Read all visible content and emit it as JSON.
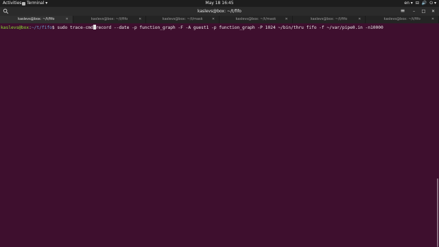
{
  "topbar": {
    "activities": "Activities",
    "app_menu": "Terminal ▾",
    "clock": "May 18  16:45",
    "tray": [
      "en ▾",
      "⊟",
      "🔊",
      "⏻ ▾"
    ]
  },
  "window": {
    "title": "kaslevs@box: ~/t/fifo"
  },
  "tabs": [
    {
      "label": "kaslevs@box: ~/t/fifo",
      "active": true
    },
    {
      "label": "kaslevs@box: ~/t/fifo",
      "active": false
    },
    {
      "label": "kaslevs@box: ~/t/mask",
      "active": false
    },
    {
      "label": "kaslevs@box: ~/t/mask",
      "active": false
    },
    {
      "label": "kaslevs@box: ~/t/fifo",
      "active": false
    },
    {
      "label": "kaslevs@box: ~/t/fifo",
      "active": false
    }
  ],
  "terminal": {
    "prompt_user": "kaslevs@box",
    "prompt_sep": ":",
    "prompt_path": "~/t/fifo",
    "prompt_end": "$ ",
    "cmd_before_cursor": "sudo trace-cmd",
    "cmd_after_cursor": "record --date -p function_graph -F -A guest1 -p function_graph -P 1024 ~/bin/thru fifo -f ~/var/pipe0.in -n10000"
  },
  "colors": {
    "background": "#3e0f2e",
    "prompt_user": "#8ae234",
    "prompt_path": "#729fcf"
  }
}
